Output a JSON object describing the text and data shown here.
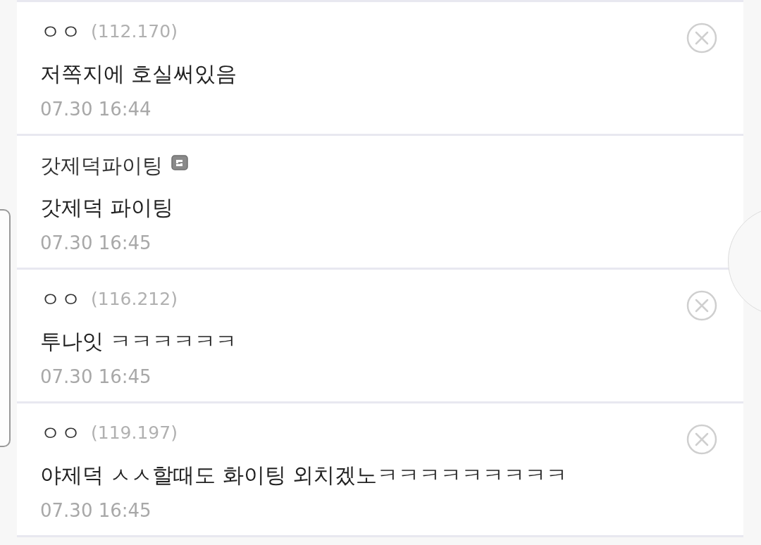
{
  "comments": [
    {
      "kind": "guest",
      "nickname": "ㅇㅇ",
      "ip": "(112.170)",
      "text": "저쪽지에 호실써있음",
      "time": "07.30 16:44"
    },
    {
      "kind": "member",
      "nickname": "갓제덕파이팅",
      "text": "갓제덕 파이팅",
      "time": "07.30 16:45"
    },
    {
      "kind": "guest",
      "nickname": "ㅇㅇ",
      "ip": "(116.212)",
      "text": "투나잇 ㅋㅋㅋㅋㅋㅋ",
      "time": "07.30 16:45"
    },
    {
      "kind": "guest",
      "nickname": "ㅇㅇ",
      "ip": "(119.197)",
      "text": "야제덕 ㅅㅅ할때도 화이팅 외치겠노ㅋㅋㅋㅋㅋㅋㅋㅋㅋ",
      "time": "07.30 16:45"
    }
  ]
}
